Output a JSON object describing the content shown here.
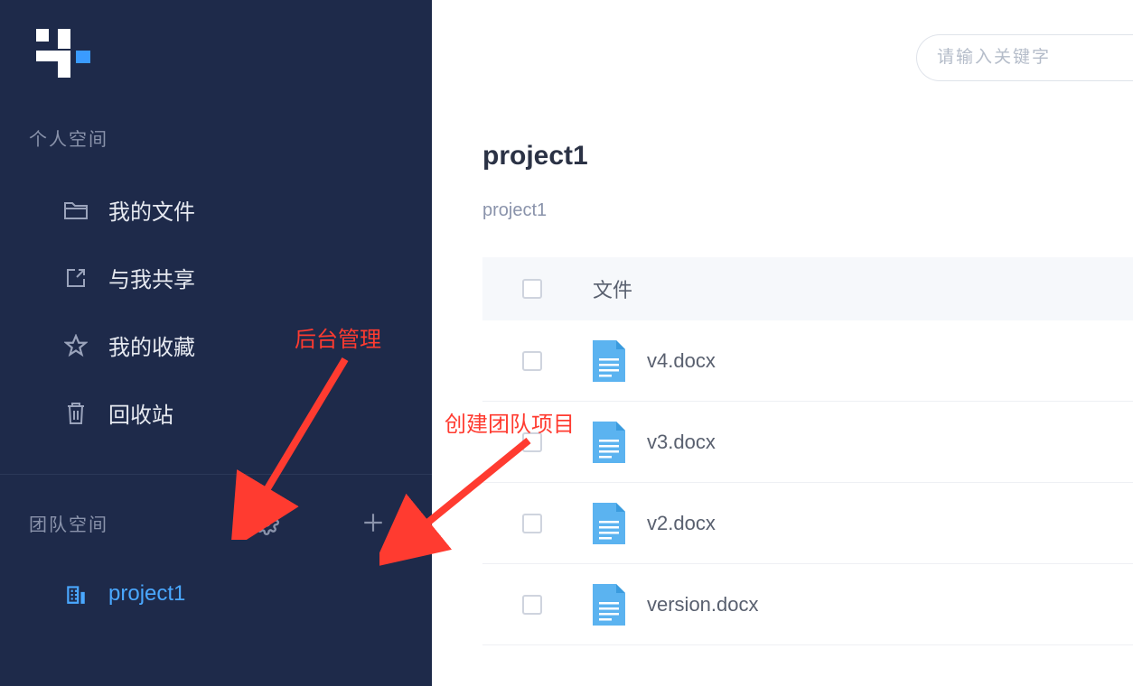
{
  "sidebar": {
    "section_personal": "个人空间",
    "section_team": "团队空间",
    "items": {
      "my_files": "我的文件",
      "shared_with_me": "与我共享",
      "favorites": "我的收藏",
      "trash": "回收站"
    },
    "team_items": [
      {
        "label": "project1"
      }
    ]
  },
  "search": {
    "placeholder": "请输入关键字"
  },
  "page": {
    "title": "project1",
    "breadcrumb": "project1"
  },
  "table": {
    "header_label": "文件",
    "rows": [
      {
        "name": "v4.docx"
      },
      {
        "name": "v3.docx"
      },
      {
        "name": "v2.docx"
      },
      {
        "name": "version.docx"
      }
    ]
  },
  "annotations": {
    "admin": "后台管理",
    "create_team": "创建团队项目"
  }
}
